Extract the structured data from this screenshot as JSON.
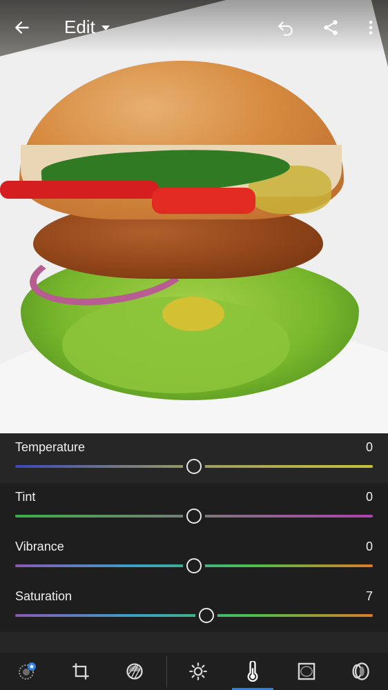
{
  "header": {
    "title": "Edit"
  },
  "sliders": [
    {
      "label": "Temperature",
      "value": "0",
      "position": 0.5,
      "gradient": [
        "#3d49b8",
        "#9b9b63",
        "#c7c23a"
      ]
    },
    {
      "label": "Tint",
      "value": "0",
      "position": 0.5,
      "gradient": [
        "#3bb04a",
        "#7a7a7a",
        "#b041b0"
      ]
    },
    {
      "label": "Vibrance",
      "value": "0",
      "position": 0.5,
      "gradient": [
        "#8a59b5",
        "#3aa0c8",
        "#4cc04a",
        "#e07a2a"
      ]
    },
    {
      "label": "Saturation",
      "value": "7",
      "position": 0.535,
      "gradient": [
        "#8a59b5",
        "#3aa0c8",
        "#4cc04a",
        "#e07a2a"
      ]
    }
  ],
  "toolbar": {
    "tools": [
      "presets-icon",
      "crop-icon",
      "selective-icon",
      "light-icon",
      "color-icon",
      "effects-icon",
      "optics-icon"
    ],
    "active": "color-icon"
  },
  "colors": {
    "accent": "#2d7fe0",
    "panel": "#262626"
  }
}
